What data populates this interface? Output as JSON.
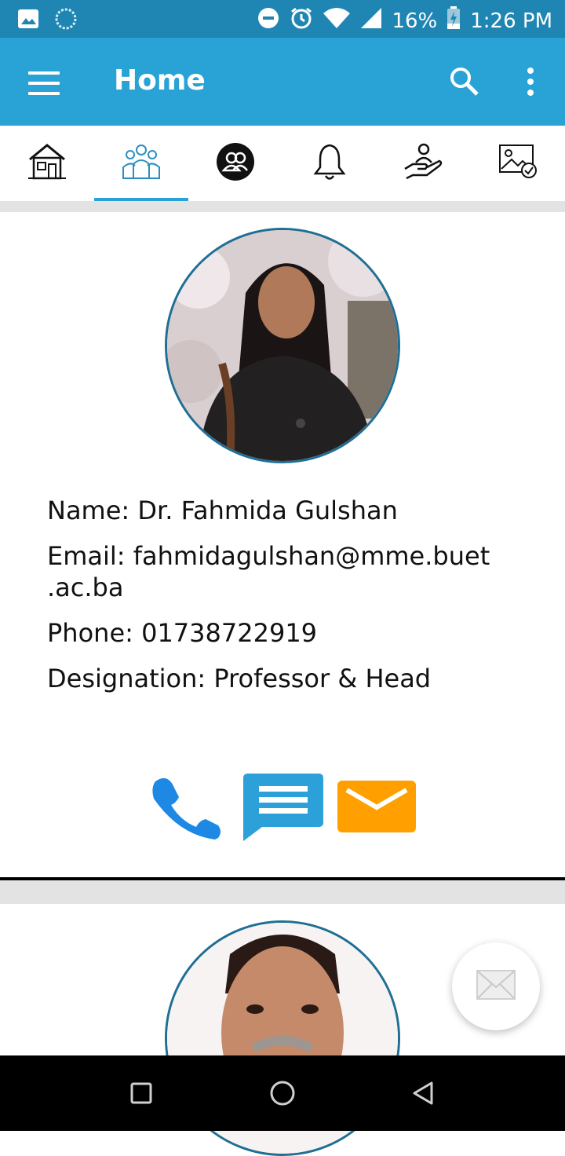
{
  "status_bar": {
    "battery": "16%",
    "time": "1:26 PM",
    "icons": [
      "image-icon",
      "sync-icon",
      "dnd-icon",
      "alarm-icon",
      "wifi-icon",
      "signal-icon",
      "battery-charging-icon"
    ]
  },
  "app_bar": {
    "title": "Home",
    "icons": [
      "menu-icon",
      "search-icon",
      "more-vert-icon"
    ]
  },
  "tabs": [
    {
      "icon": "house-icon",
      "selected": false
    },
    {
      "icon": "people-group-icon",
      "selected": true
    },
    {
      "icon": "users-circle-icon",
      "selected": false
    },
    {
      "icon": "bell-icon",
      "selected": false
    },
    {
      "icon": "hand-person-icon",
      "selected": false
    },
    {
      "icon": "gallery-check-icon",
      "selected": false
    }
  ],
  "profile_1": {
    "name_line": "Name: Dr. Fahmida Gulshan",
    "email_line": "Email: fahmidagulshan@mme.buet\n.ac.ba",
    "phone_line": "Phone: 01738722919",
    "designation_line": "Designation: Professor & Head"
  },
  "actions": {
    "icons": [
      "phone-icon",
      "message-icon",
      "email-icon"
    ],
    "colors": {
      "phone": "#1e88e5",
      "message": "#2ca0d8",
      "email": "#ffa000"
    }
  },
  "fab": {
    "icon": "envelope-icon"
  },
  "nav_bar": {
    "icons": [
      "recents-icon",
      "home-circle-icon",
      "back-icon"
    ]
  },
  "colors": {
    "status": "#1f86b3",
    "appbar": "#29a3d6",
    "accent": "#29a3d6"
  }
}
